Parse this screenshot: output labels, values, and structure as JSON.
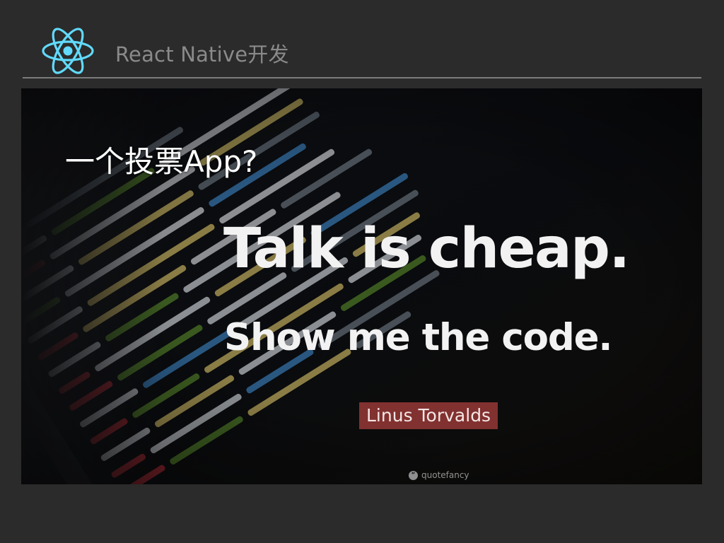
{
  "header": {
    "title": "React Native开发",
    "logo_icon": "react-logo-icon",
    "logo_color": "#61dafb"
  },
  "slide": {
    "heading": "一个投票App?"
  },
  "quote": {
    "line1": "Talk is cheap.",
    "line2": "Show me the code.",
    "author": "Linus Torvalds",
    "watermark": "quotefancy",
    "watermark_icon": "quote-icon"
  },
  "colors": {
    "background": "#2b2b2b",
    "divider": "#7c7c7c",
    "header_text": "#8a8a8a",
    "author_badge": "#963836"
  }
}
